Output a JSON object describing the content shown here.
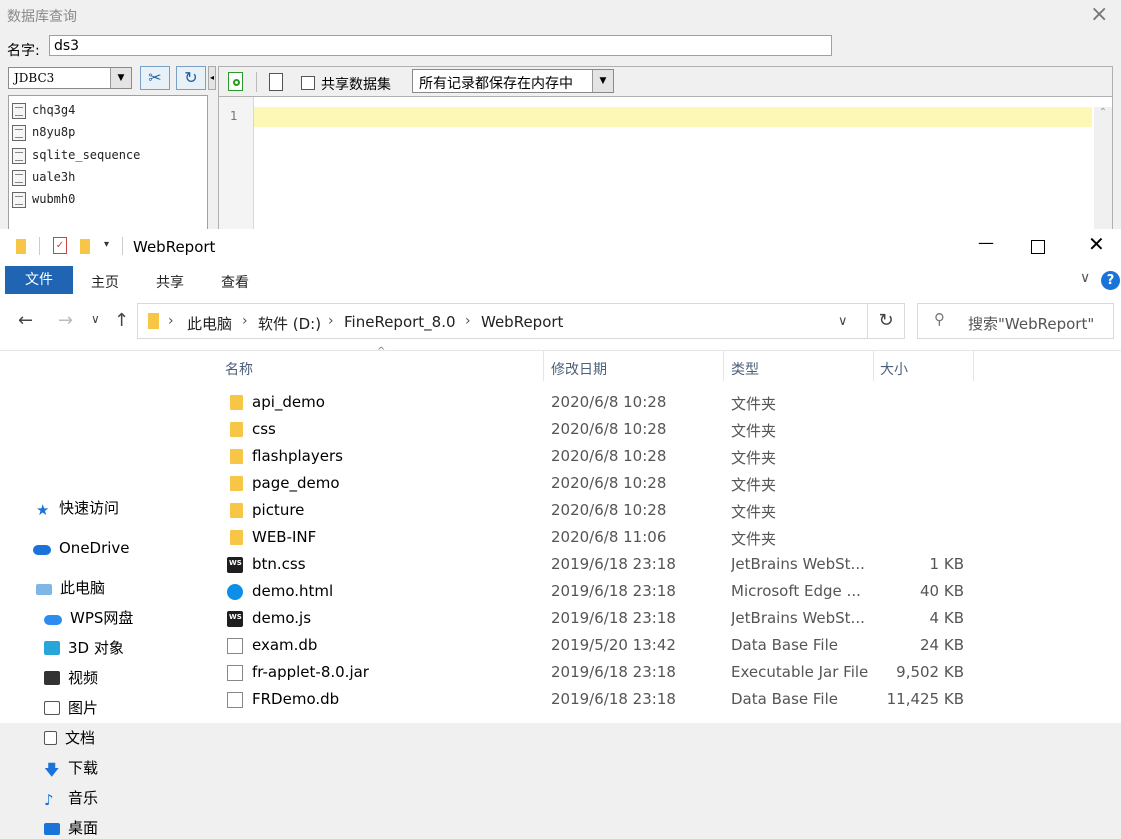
{
  "dialog": {
    "title": "数据库查询",
    "close": "×",
    "name_label": "名字:",
    "name_value": "ds3",
    "connection": "JDBC3",
    "tables": [
      "chq3g4",
      "n8yu8p",
      "sqlite_sequence",
      "uale3h",
      "wubmh0"
    ],
    "share_label": "共享数据集",
    "storage_select": "所有记录都保存在内存中",
    "line_number": "1"
  },
  "explorer": {
    "title": "WebReport",
    "ribbon_tabs": [
      "文件",
      "主页",
      "共享",
      "查看"
    ],
    "breadcrumbs": [
      "此电脑",
      "软件 (D:)",
      "FineReport_8.0",
      "WebReport"
    ],
    "search_placeholder": "搜索\"WebReport\"",
    "nav": [
      "快速访问",
      "OneDrive",
      "此电脑",
      "WPS网盘",
      "3D 对象",
      "视频",
      "图片",
      "文档",
      "下载",
      "音乐",
      "桌面"
    ],
    "columns": [
      "名称",
      "修改日期",
      "类型",
      "大小"
    ],
    "files": [
      {
        "name": "api_demo",
        "date": "2020/6/8 10:28",
        "type": "文件夹",
        "size": "",
        "icon": "folder-icon"
      },
      {
        "name": "css",
        "date": "2020/6/8 10:28",
        "type": "文件夹",
        "size": "",
        "icon": "folder-icon"
      },
      {
        "name": "flashplayers",
        "date": "2020/6/8 10:28",
        "type": "文件夹",
        "size": "",
        "icon": "folder-icon"
      },
      {
        "name": "page_demo",
        "date": "2020/6/8 10:28",
        "type": "文件夹",
        "size": "",
        "icon": "folder-icon"
      },
      {
        "name": "picture",
        "date": "2020/6/8 10:28",
        "type": "文件夹",
        "size": "",
        "icon": "folder-icon"
      },
      {
        "name": "WEB-INF",
        "date": "2020/6/8 11:06",
        "type": "文件夹",
        "size": "",
        "icon": "folder-icon"
      },
      {
        "name": "btn.css",
        "date": "2019/6/18 23:18",
        "type": "JetBrains WebSt...",
        "size": "1 KB",
        "icon": "webstorm-icon"
      },
      {
        "name": "demo.html",
        "date": "2019/6/18 23:18",
        "type": "Microsoft Edge ...",
        "size": "40 KB",
        "icon": "edge-icon"
      },
      {
        "name": "demo.js",
        "date": "2019/6/18 23:18",
        "type": "JetBrains WebSt...",
        "size": "4 KB",
        "icon": "webstorm-icon"
      },
      {
        "name": "exam.db",
        "date": "2019/5/20 13:42",
        "type": "Data Base File",
        "size": "24 KB",
        "icon": "db-file-icon"
      },
      {
        "name": "fr-applet-8.0.jar",
        "date": "2019/6/18 23:18",
        "type": "Executable Jar File",
        "size": "9,502 KB",
        "icon": "jar-file-icon"
      },
      {
        "name": "FRDemo.db",
        "date": "2019/6/18 23:18",
        "type": "Data Base File",
        "size": "11,425 KB",
        "icon": "db-file-icon"
      }
    ]
  }
}
